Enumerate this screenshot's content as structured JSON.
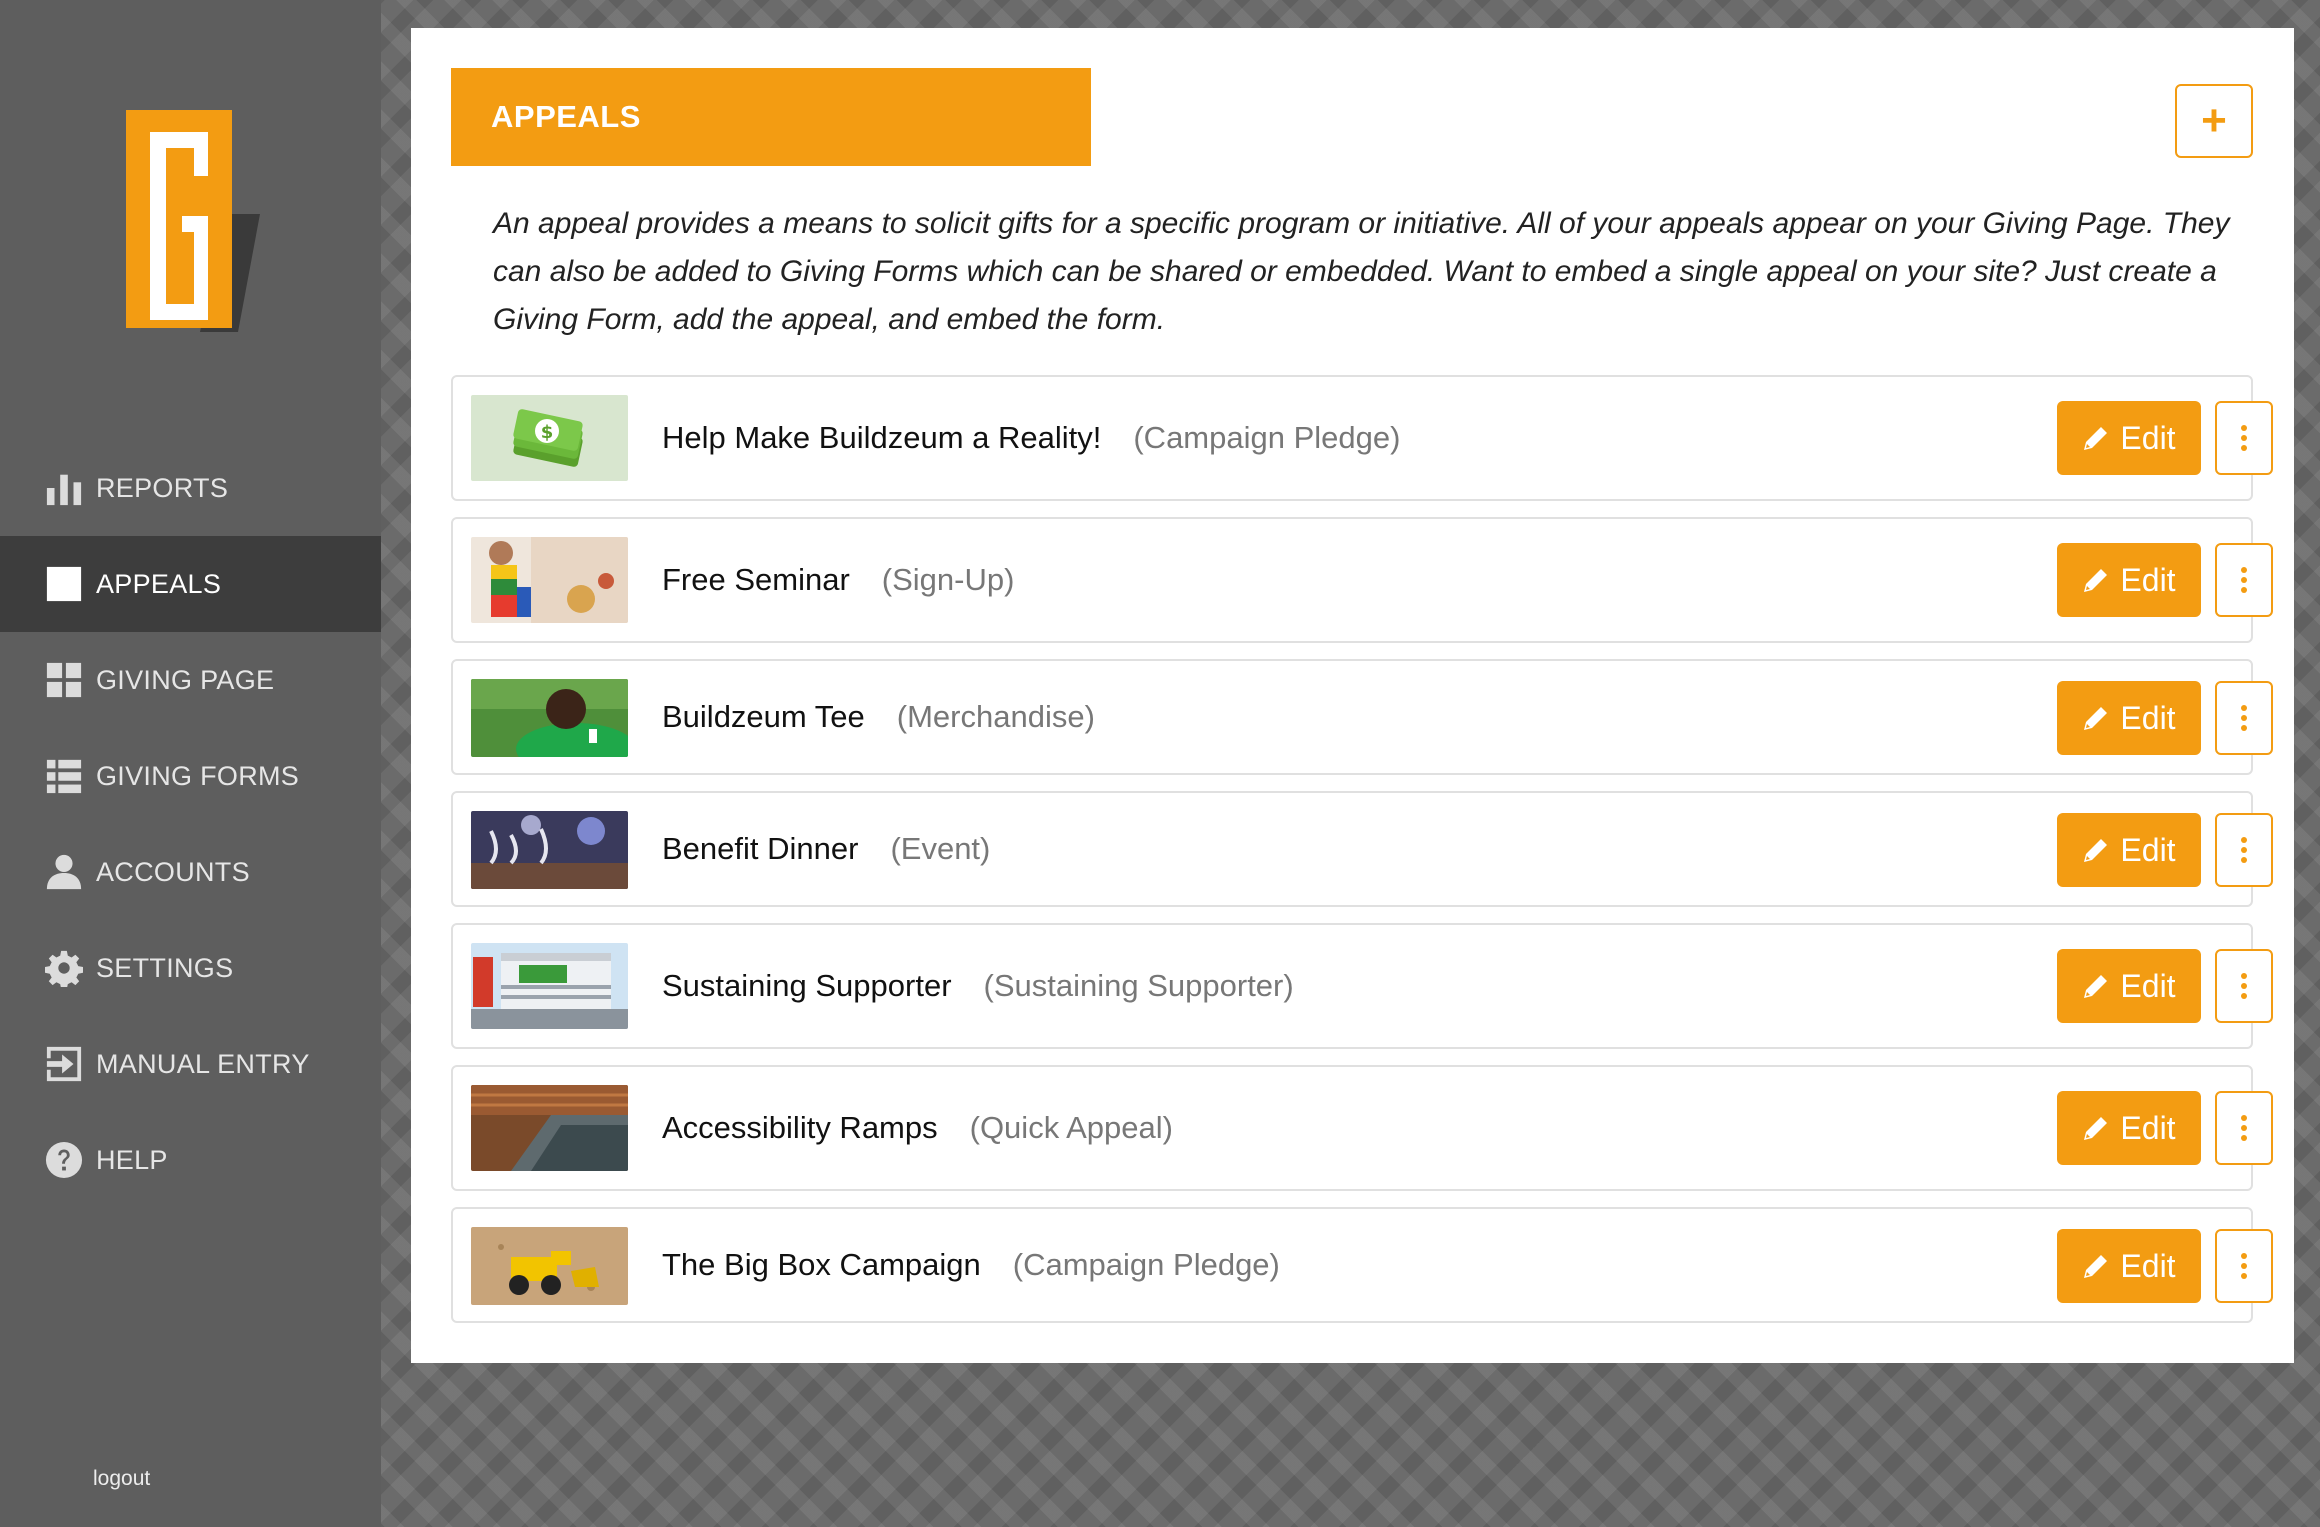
{
  "sidebar": {
    "logo": "buildzeum-g-logo",
    "items": [
      {
        "label": "REPORTS",
        "icon": "bar-chart-icon",
        "active": false
      },
      {
        "label": "APPEALS",
        "icon": "square-icon",
        "active": true
      },
      {
        "label": "GIVING PAGE",
        "icon": "grid-icon",
        "active": false
      },
      {
        "label": "GIVING FORMS",
        "icon": "list-icon",
        "active": false
      },
      {
        "label": "ACCOUNTS",
        "icon": "user-icon",
        "active": false
      },
      {
        "label": "SETTINGS",
        "icon": "gear-icon",
        "active": false
      },
      {
        "label": "MANUAL ENTRY",
        "icon": "arrow-right-icon",
        "active": false
      },
      {
        "label": "HELP",
        "icon": "question-icon",
        "active": false
      }
    ],
    "logout_label": "logout"
  },
  "main": {
    "title": "APPEALS",
    "add_button_label": "+",
    "description": "An appeal provides a means to solicit gifts for a specific program or initiative. All of your appeals appear on your Giving Page. They can also be added to Giving Forms which can be shared or embedded. Want to embed a single appeal on your site? Just create a Giving Form, add the appeal, and embed the form.",
    "edit_label": "Edit",
    "appeals": [
      {
        "name": "Help Make Buildzeum a Reality!",
        "type": "(Campaign Pledge)"
      },
      {
        "name": "Free Seminar",
        "type": "(Sign-Up)"
      },
      {
        "name": "Buildzeum Tee",
        "type": "(Merchandise)"
      },
      {
        "name": "Benefit Dinner",
        "type": "(Event)"
      },
      {
        "name": "Sustaining Supporter",
        "type": "(Sustaining Supporter)"
      },
      {
        "name": "Accessibility Ramps",
        "type": "(Quick Appeal)"
      },
      {
        "name": "The Big Box Campaign",
        "type": "(Campaign Pledge)"
      }
    ]
  },
  "colors": {
    "accent": "#f39c12",
    "sidebar": "#5e5e5e",
    "sidebar_active": "#3d3d3d"
  }
}
